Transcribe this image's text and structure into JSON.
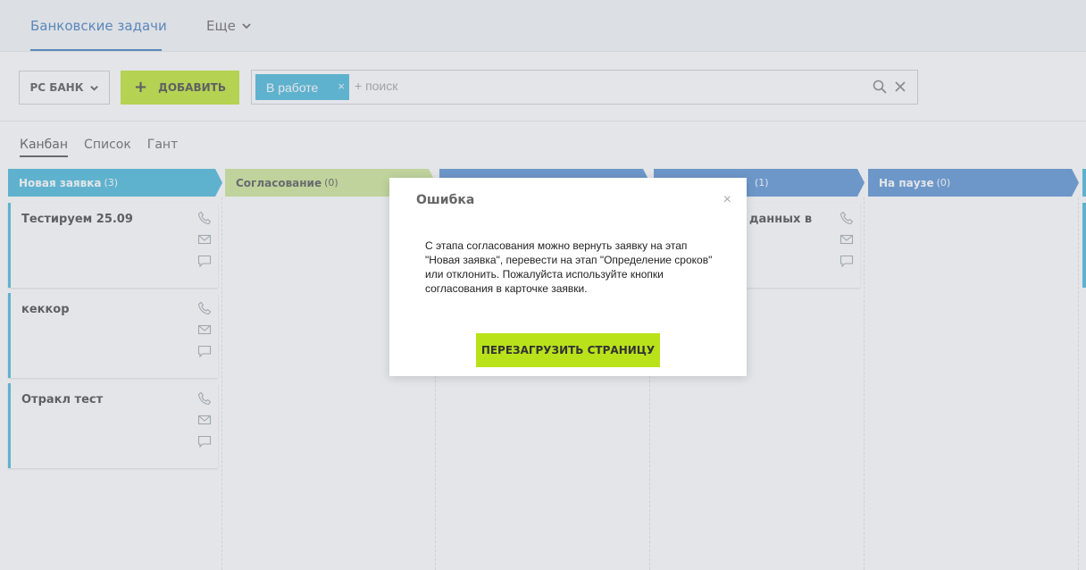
{
  "topbar": {
    "main_tab": "Банковские задачи",
    "more_tab": "Еще"
  },
  "toolbar": {
    "bank_label": "РС БАНК",
    "add_label": "ДОБАВИТЬ",
    "filter_chip": "В работе",
    "search_placeholder": "+ поиск"
  },
  "views": [
    {
      "label": "Канбан",
      "active": true
    },
    {
      "label": "Список",
      "active": false
    },
    {
      "label": "Гант",
      "active": false
    }
  ],
  "columns": [
    {
      "title": "Новая заявка",
      "count": "(3)",
      "color": "#35b1d8"
    },
    {
      "title": "Согласование",
      "count": "(0)",
      "color": "#c9e38a"
    },
    {
      "title": "",
      "count": "",
      "color": "#4a88d0"
    },
    {
      "title": "",
      "count": "(1)",
      "color": "#4a88d0"
    },
    {
      "title": "На паузе",
      "count": "(0)",
      "color": "#4a88d0"
    }
  ],
  "cards": [
    {
      "title": "Тестируем 25.09"
    },
    {
      "title": "кеккор"
    },
    {
      "title": "Отракл тест"
    },
    {
      "title": "данных в"
    }
  ],
  "modal": {
    "title": "Ошибка",
    "close": "×",
    "message": "С этапа согласования можно вернуть заявку на этап \"Новая заявка\", перевести на этап \"Определение сроков\" или отклонить. Пожалуйста используйте кнопки согласования в карточке заявки.",
    "button": "ПЕРЕЗАГРУЗИТЬ СТРАНИЦУ"
  },
  "colors": {
    "accent_blue": "#2f6fb8",
    "accent_green": "#b9e21a",
    "chip_blue": "#35b1d8"
  }
}
